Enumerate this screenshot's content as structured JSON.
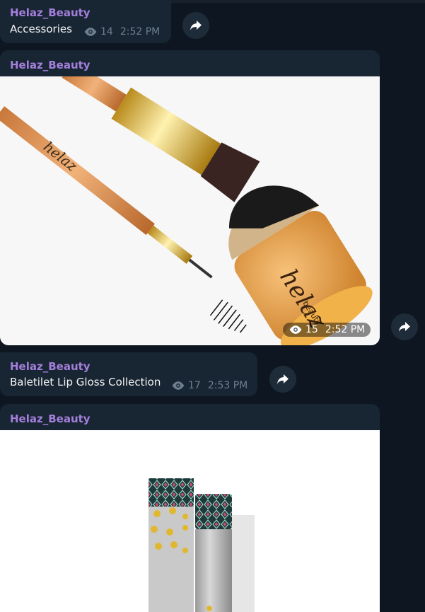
{
  "messages": [
    {
      "author": "Helaz_Beauty",
      "text": "Accessories",
      "views": "14",
      "time": "2:52 PM"
    },
    {
      "author": "Helaz_Beauty",
      "views": "15",
      "time": "2:52 PM",
      "image": "makeup-brushes-photo"
    },
    {
      "author": "Helaz_Beauty",
      "text": "Baletilet Lip Gloss Collection",
      "views": "17",
      "time": "2:53 PM"
    },
    {
      "author": "Helaz_Beauty",
      "image": "lip-gloss-photo"
    }
  ],
  "colors": {
    "background": "#0e1621",
    "bubble": "#182533",
    "author": "#a47fdb",
    "meta": "#6d7f8f"
  },
  "photo_brand": {
    "logo": "helaz",
    "sub": "beauty"
  }
}
